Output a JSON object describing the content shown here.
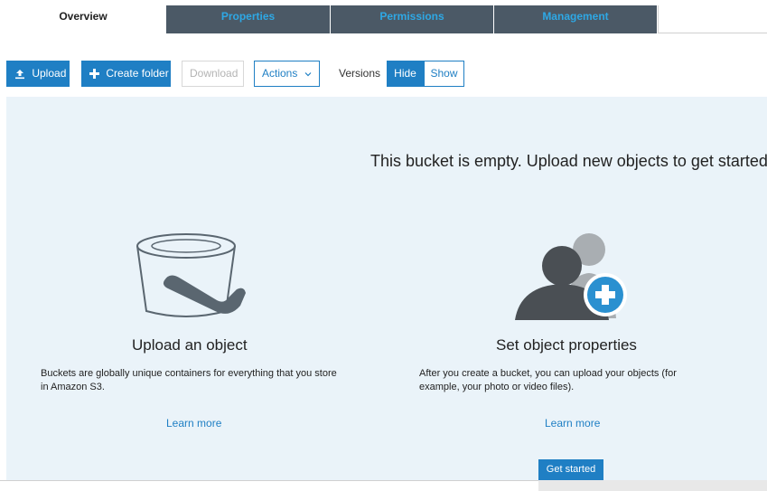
{
  "tabs": [
    {
      "label": "Overview",
      "active": true
    },
    {
      "label": "Properties",
      "active": false
    },
    {
      "label": "Permissions",
      "active": false
    },
    {
      "label": "Management",
      "active": false
    }
  ],
  "toolbar": {
    "upload_label": "Upload",
    "create_folder_label": "Create folder",
    "download_label": "Download",
    "actions_label": "Actions",
    "versions_label": "Versions",
    "hide_label": "Hide",
    "show_label": "Show"
  },
  "main": {
    "empty_message": "This bucket is empty. Upload new objects to get started",
    "upload_col": {
      "title": "Upload an object",
      "description": "Buckets are globally unique containers for everything that you store in Amazon S3.",
      "learn_more": "Learn more"
    },
    "properties_col": {
      "title": "Set object properties",
      "description": "After you create a bucket, you can upload your objects (for example, your photo or video files).",
      "learn_more": "Learn more"
    },
    "get_started_label": "Get started"
  },
  "colors": {
    "accent": "#1f7fc4",
    "tab_dark": "#4b5966",
    "tab_text": "#2ea8e5",
    "panel_bg": "#eaf3f9"
  },
  "icons": [
    "upload-icon",
    "plus-icon",
    "chevron-down-icon",
    "bucket-icon",
    "users-add-icon"
  ]
}
